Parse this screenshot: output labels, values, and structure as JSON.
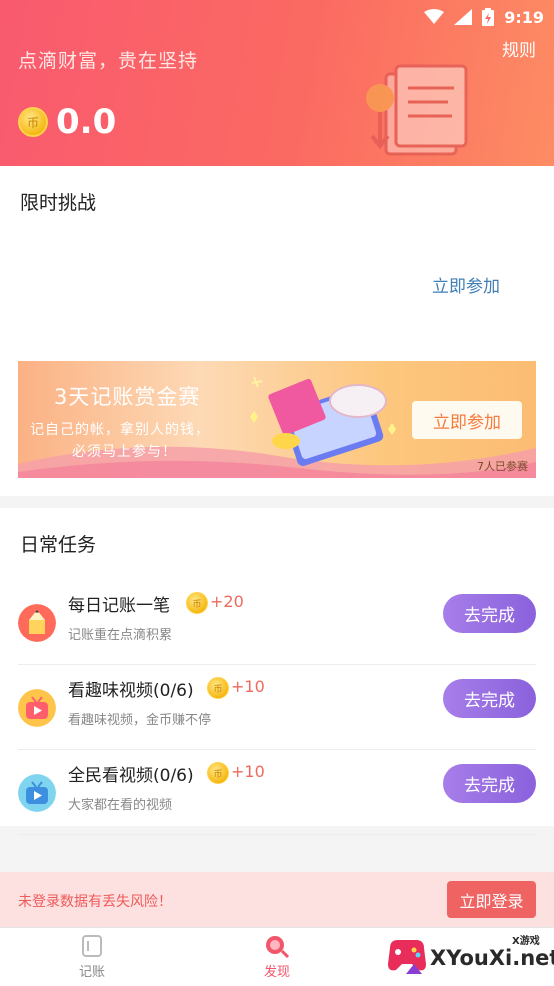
{
  "status_bar": {
    "time": "9:19",
    "icons": [
      "wifi-icon",
      "signal-icon",
      "battery-charging-icon"
    ]
  },
  "header": {
    "slogan": "点滴财富，贵在坚持",
    "rules_label": "规则",
    "coin_symbol": "币",
    "balance": "0.0"
  },
  "challenge": {
    "title": "限时挑战",
    "join_label": "立即参加",
    "banner": {
      "title": "3天记账赏金赛",
      "subtitle_line1": "记自己的帐，拿别人的钱，",
      "subtitle_line2": "必须马上参与！",
      "button_label": "立即参加",
      "participants": "7人已参赛"
    }
  },
  "daily_tasks": {
    "title": "日常任务",
    "coin_symbol": "币",
    "items": [
      {
        "name": "每日记账一笔",
        "reward": "+20",
        "desc": "记账重在点滴积累",
        "button": "去完成",
        "icon": "pencil-icon"
      },
      {
        "name": "看趣味视频(0/6)",
        "reward": "+10",
        "desc": "看趣味视频，金币赚不停",
        "button": "去完成",
        "icon": "video-tv-icon"
      },
      {
        "name": "全民看视频(0/6)",
        "reward": "+10",
        "desc": "大家都在看的视频",
        "button": "去完成",
        "icon": "play-tv-icon"
      }
    ]
  },
  "login_bar": {
    "warning": "未登录数据有丢失风险！",
    "button": "立即登录"
  },
  "bottom_nav": {
    "items": [
      {
        "label": "记账",
        "icon": "ledger-icon",
        "active": false
      },
      {
        "label": "发现",
        "icon": "discover-icon",
        "active": true
      }
    ]
  },
  "watermark": {
    "text": "XYouXi.net",
    "small": "X游戏"
  },
  "colors": {
    "header_gradient_start": "#f95a6f",
    "header_gradient_end": "#fd8c63",
    "task_button": "#8a61dc",
    "reward": "#ef6a5d",
    "login_button": "#ef6363",
    "link": "#3f7fb5"
  }
}
